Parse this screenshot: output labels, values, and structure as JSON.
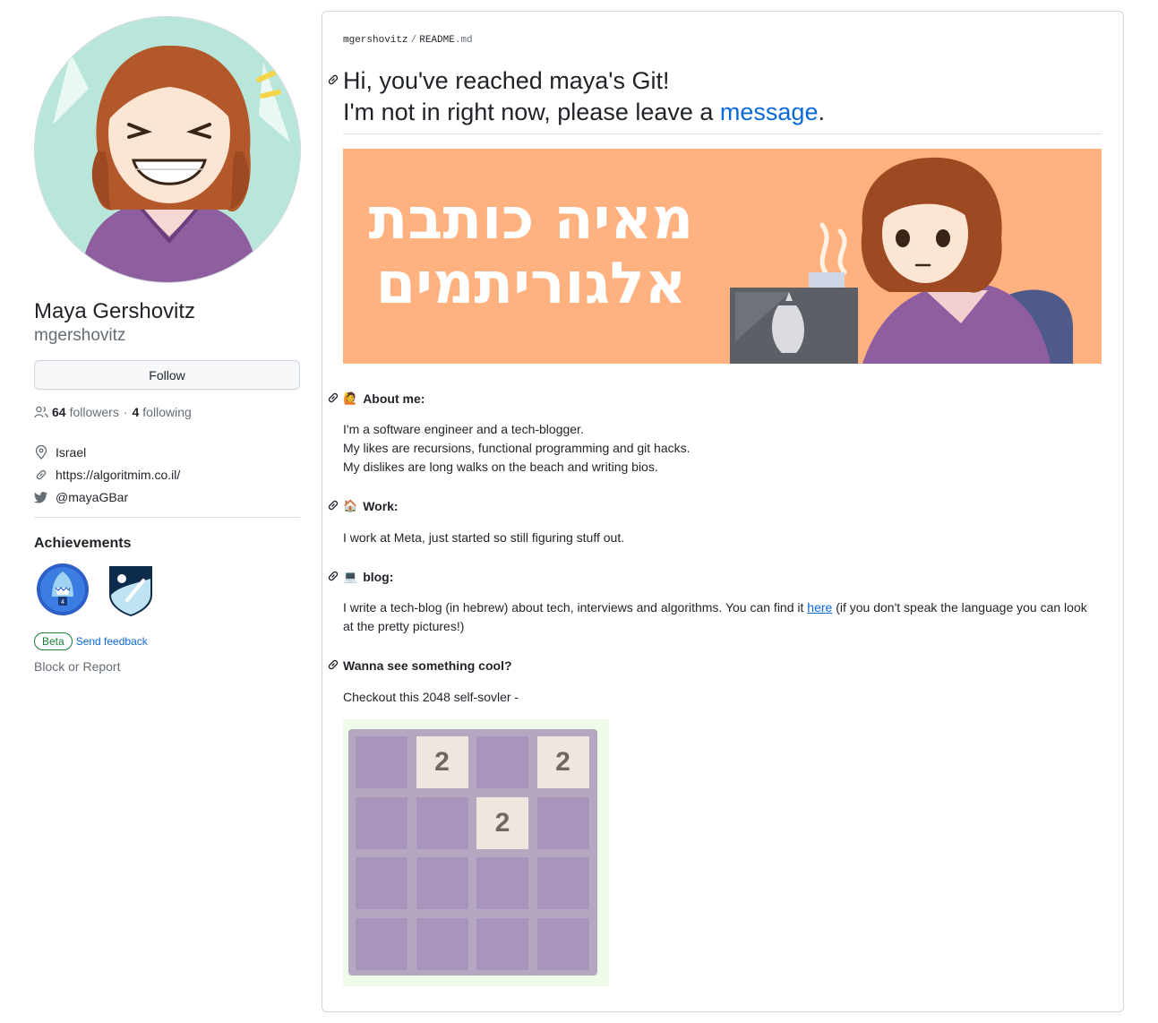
{
  "profile": {
    "name": "Maya Gershovitz",
    "login": "mgershovitz",
    "follow_label": "Follow",
    "followers_count": "64",
    "followers_label": "followers",
    "separator": "·",
    "following_count": "4",
    "following_label": "following",
    "location": "Israel",
    "website": "https://algoritmim.co.il/",
    "twitter": "@mayaGBar",
    "achievements_title": "Achievements",
    "beta_label": "Beta",
    "feedback_label": "Send feedback",
    "block_label": "Block or Report"
  },
  "readme": {
    "breadcrumb_owner": "mgershovitz",
    "breadcrumb_sep": "/",
    "breadcrumb_file": "README",
    "breadcrumb_ext": ".md",
    "title_line1": "Hi, you've reached maya's Git!",
    "title_line2_prefix": "I'm not in right now, please leave a ",
    "title_line2_link": "message",
    "title_line2_suffix": ".",
    "banner_text_line1": "מאיה כותבת",
    "banner_text_line2": "אלגוריתמים",
    "sections": [
      {
        "emoji": "🙋",
        "heading": "About me:",
        "lines": [
          "I'm a software engineer and a tech-blogger.",
          "My likes are recursions, functional programming and git hacks.",
          "My dislikes are long walks on the beach and writing bios."
        ]
      },
      {
        "emoji": "🏠",
        "heading": "Work:",
        "lines": [
          "I work at Meta, just started so still figuring stuff out."
        ]
      },
      {
        "emoji": "💻",
        "heading": "blog:",
        "text_before": "I write a tech-blog (in hebrew) about tech, interviews and algorithms. You can find it ",
        "link": "here",
        "text_after": " (if you don't speak the language you can look at the pretty pictures!)"
      },
      {
        "heading": "Wanna see something cool?",
        "lines": [
          "Checkout this 2048 self-sovler -"
        ]
      }
    ],
    "game_tiles": [
      "",
      "2",
      "",
      "2",
      "",
      "",
      "2",
      "",
      "",
      "",
      "",
      "",
      "",
      "",
      "",
      ""
    ]
  },
  "colors": {
    "link": "#0969da",
    "banner_bg": "#ffb27f",
    "avatar_bg": "#b8e6da",
    "sweater": "#8f5e9e",
    "hair": "#b3582a",
    "tile_empty": "#a894bd",
    "tile_filled": "#efe6df"
  },
  "icons": [
    "people-icon",
    "location-icon",
    "link-icon",
    "twitter-icon",
    "anchor-link-icon",
    "shark-badge-icon",
    "arctic-badge-icon"
  ]
}
